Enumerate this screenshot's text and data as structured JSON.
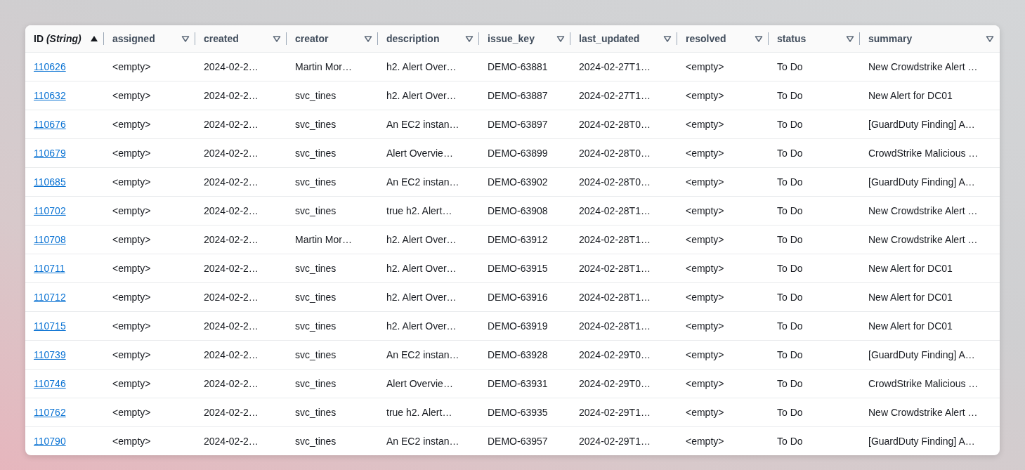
{
  "table": {
    "columns": [
      {
        "label": "ID *(String)*",
        "sorted": true
      },
      {
        "label": "assigned",
        "sorted": false
      },
      {
        "label": "created",
        "sorted": false
      },
      {
        "label": "creator",
        "sorted": false
      },
      {
        "label": "description",
        "sorted": false
      },
      {
        "label": "issue_key",
        "sorted": false
      },
      {
        "label": "last_updated",
        "sorted": false
      },
      {
        "label": "resolved",
        "sorted": false
      },
      {
        "label": "status",
        "sorted": false
      },
      {
        "label": "summary",
        "sorted": false
      }
    ],
    "rows": [
      [
        "110626",
        "<empty>",
        "2024-02-2…",
        "Martin Mor…",
        "h2. Alert Over…",
        "DEMO-63881",
        "2024-02-27T1…",
        "<empty>",
        "To Do",
        "New Crowdstrike Alert …"
      ],
      [
        "110632",
        "<empty>",
        "2024-02-2…",
        "svc_tines",
        "h2. Alert Over…",
        "DEMO-63887",
        "2024-02-27T1…",
        "<empty>",
        "To Do",
        "New Alert for DC01"
      ],
      [
        "110676",
        "<empty>",
        "2024-02-2…",
        "svc_tines",
        "An EC2 instan…",
        "DEMO-63897",
        "2024-02-28T0…",
        "<empty>",
        "To Do",
        "[GuardDuty Finding] A…"
      ],
      [
        "110679",
        "<empty>",
        "2024-02-2…",
        "svc_tines",
        "Alert Overvie…",
        "DEMO-63899",
        "2024-02-28T0…",
        "<empty>",
        "To Do",
        "CrowdStrike Malicious …"
      ],
      [
        "110685",
        "<empty>",
        "2024-02-2…",
        "svc_tines",
        "An EC2 instan…",
        "DEMO-63902",
        "2024-02-28T0…",
        "<empty>",
        "To Do",
        "[GuardDuty Finding] A…"
      ],
      [
        "110702",
        "<empty>",
        "2024-02-2…",
        "svc_tines",
        "true  h2. Alert…",
        "DEMO-63908",
        "2024-02-28T1…",
        "<empty>",
        "To Do",
        "New Crowdstrike Alert …"
      ],
      [
        "110708",
        "<empty>",
        "2024-02-2…",
        "Martin Mor…",
        "h2. Alert Over…",
        "DEMO-63912",
        "2024-02-28T1…",
        "<empty>",
        "To Do",
        "New Crowdstrike Alert …"
      ],
      [
        "110711",
        "<empty>",
        "2024-02-2…",
        "svc_tines",
        "h2. Alert Over…",
        "DEMO-63915",
        "2024-02-28T1…",
        "<empty>",
        "To Do",
        "New Alert for DC01"
      ],
      [
        "110712",
        "<empty>",
        "2024-02-2…",
        "svc_tines",
        "h2. Alert Over…",
        "DEMO-63916",
        "2024-02-28T1…",
        "<empty>",
        "To Do",
        "New Alert for DC01"
      ],
      [
        "110715",
        "<empty>",
        "2024-02-2…",
        "svc_tines",
        "h2. Alert Over…",
        "DEMO-63919",
        "2024-02-28T1…",
        "<empty>",
        "To Do",
        "New Alert for DC01"
      ],
      [
        "110739",
        "<empty>",
        "2024-02-2…",
        "svc_tines",
        "An EC2 instan…",
        "DEMO-63928",
        "2024-02-29T0…",
        "<empty>",
        "To Do",
        "[GuardDuty Finding] A…"
      ],
      [
        "110746",
        "<empty>",
        "2024-02-2…",
        "svc_tines",
        "Alert Overvie…",
        "DEMO-63931",
        "2024-02-29T0…",
        "<empty>",
        "To Do",
        "CrowdStrike Malicious …"
      ],
      [
        "110762",
        "<empty>",
        "2024-02-2…",
        "svc_tines",
        "true  h2. Alert…",
        "DEMO-63935",
        "2024-02-29T1…",
        "<empty>",
        "To Do",
        "New Crowdstrike Alert …"
      ],
      [
        "110790",
        "<empty>",
        "2024-02-2…",
        "svc_tines",
        "An EC2 instan…",
        "DEMO-63957",
        "2024-02-29T1…",
        "<empty>",
        "To Do",
        "[GuardDuty Finding] A…"
      ]
    ]
  }
}
